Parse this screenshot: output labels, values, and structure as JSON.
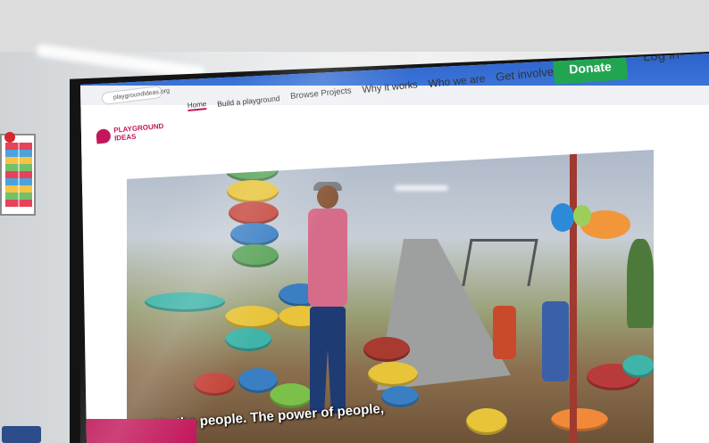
{
  "browser": {
    "url": "playgroundideas.org"
  },
  "site": {
    "logo_text": "PLAYGROUND IDEAS",
    "nav": [
      {
        "label": "Home"
      },
      {
        "label": "Build a playground"
      },
      {
        "label": "Browse Projects"
      },
      {
        "label": "Why it works"
      },
      {
        "label": "Who we are"
      },
      {
        "label": "Get involved"
      }
    ],
    "donate_label": "Donate",
    "login_label": "Log in"
  },
  "video": {
    "subtitle": "it's the people. The power of people,"
  },
  "colors": {
    "brand_pink": "#c2185b",
    "donate_green": "#21a551",
    "browser_blue": "#2c63c9"
  }
}
